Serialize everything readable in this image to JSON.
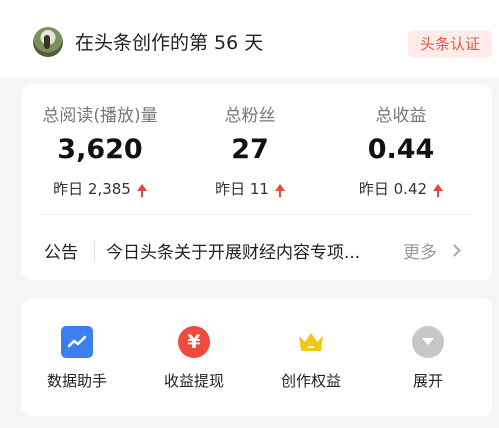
{
  "header": {
    "title": "在头条创作的第 56 天",
    "badge": "头条认证"
  },
  "stats": [
    {
      "label": "总阅读(播放)量",
      "value": "3,620",
      "change": "昨日 2,385"
    },
    {
      "label": "总粉丝",
      "value": "27",
      "change": "昨日 11"
    },
    {
      "label": "总收益",
      "value": "0.44",
      "change": "昨日 0.42"
    }
  ],
  "notice": {
    "label": "公告",
    "text": "今日头条关于开展财经内容专项...",
    "more": "更多"
  },
  "tools": [
    {
      "label": "数据助手",
      "icon": "data-chart-icon",
      "color": "#3d7ef0"
    },
    {
      "label": "收益提现",
      "icon": "yuan-icon",
      "color": "#ee4a3f"
    },
    {
      "label": "创作权益",
      "icon": "crown-icon",
      "color": "#f5c518"
    },
    {
      "label": "展开",
      "icon": "chevron-down-icon",
      "color": "#c7c7c7"
    }
  ]
}
